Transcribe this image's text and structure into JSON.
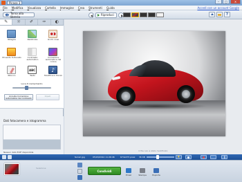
{
  "window": {
    "title": "Picasa 3",
    "controls": [
      "–",
      "▢",
      "✕"
    ]
  },
  "menubar": {
    "items": [
      "File",
      "Modifica",
      "Visualizza",
      "Cartella",
      "Immagine",
      "Crea",
      "Strumenti",
      "Guida"
    ],
    "account_link": "Accedi con un account Google"
  },
  "navbar": {
    "back_label": "Torna alla libreria",
    "play_label": "Riproduci"
  },
  "tools": [
    {
      "label": "Ritaglia",
      "icon": "crop-icon"
    },
    {
      "label": "Raddrizza",
      "icon": "straighten-icon"
    },
    {
      "label": "Occhi rossi",
      "icon": "redeye-icon"
    },
    {
      "label": "Mi sento fortunato",
      "icon": "lucky-icon"
    },
    {
      "label": "Contrasto automatico",
      "icon": "auto-contrast-icon"
    },
    {
      "label": "Correzione automatica del colore",
      "icon": "auto-color-icon"
    },
    {
      "label": "Ritocco",
      "icon": "retouch-icon"
    },
    {
      "label": "Testo",
      "icon": "text-icon"
    },
    {
      "label": "Modifica in Picnik",
      "icon": "music-icon"
    }
  ],
  "fill_light": {
    "label": "Luce di riempimento",
    "level": 0.32
  },
  "buttons": {
    "redeye_auto": "Annulla Correzione automatica del contrasto",
    "undo": "Ripeti"
  },
  "histogram": {
    "title": "Dati fotocamera e istogramma",
    "note": "Nessun dato EXIF disponibile"
  },
  "viewer": {
    "status": "Il file non è stato modificato"
  },
  "infobar": {
    "filename": "ferrari.jpg",
    "date": "05/03/2012 11:26:46",
    "dimensions": "674x475 pixel",
    "size": "36 KB"
  },
  "tray": {
    "selection_label": "Selezione",
    "create_label": "Condividi",
    "share": [
      {
        "label": "Email",
        "icon": "email-icon"
      },
      {
        "label": "Stampa",
        "icon": "print-icon"
      },
      {
        "label": "Esporta",
        "icon": "export-icon"
      }
    ]
  },
  "colors": {
    "infobar": "#2f68b4",
    "create_button": "#3a9e2e",
    "car": "#c2141d"
  }
}
